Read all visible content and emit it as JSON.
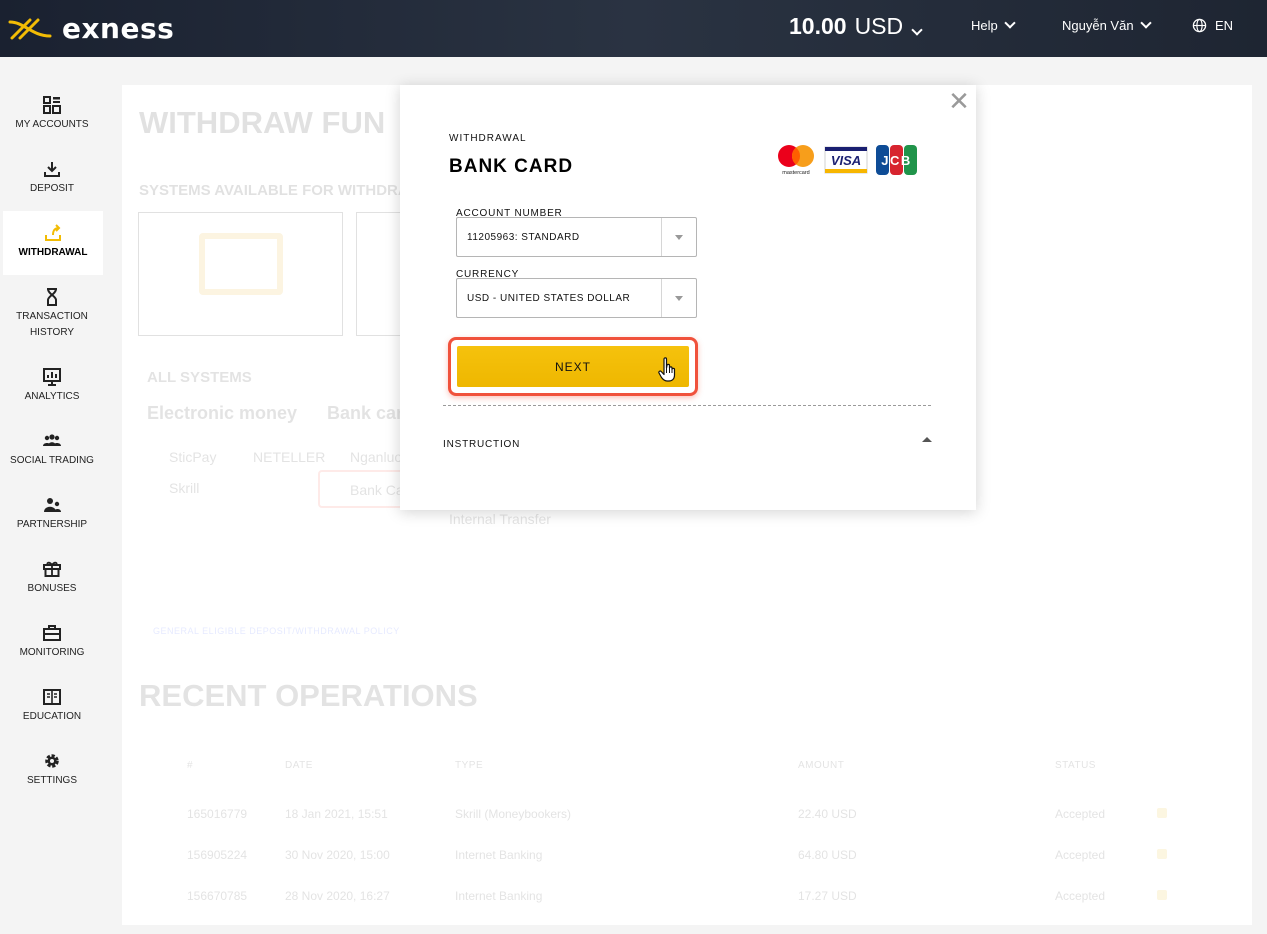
{
  "header": {
    "brand": "exness",
    "balance_amount": "10.00",
    "balance_currency": "USD",
    "help": "Help",
    "user": "Nguyễn Văn",
    "language": "EN"
  },
  "sidebar": {
    "items": [
      {
        "label": "MY ACCOUNTS",
        "icon": "grid-icon"
      },
      {
        "label": "DEPOSIT",
        "icon": "download-icon"
      },
      {
        "label": "WITHDRAWAL",
        "icon": "upload-icon"
      },
      {
        "label": "TRANSACTION HISTORY",
        "icon": "hourglass-icon"
      },
      {
        "label": "ANALYTICS",
        "icon": "chart-board-icon"
      },
      {
        "label": "SOCIAL TRADING",
        "icon": "users-icon"
      },
      {
        "label": "PARTNERSHIP",
        "icon": "partners-icon"
      },
      {
        "label": "BONUSES",
        "icon": "gift-icon"
      },
      {
        "label": "MONITORING",
        "icon": "briefcase-icon"
      },
      {
        "label": "EDUCATION",
        "icon": "book-icon"
      },
      {
        "label": "SETTINGS",
        "icon": "gear-icon"
      }
    ],
    "active_index": 2
  },
  "background": {
    "title": "WITHDRAW FUN",
    "systems_available": "SYSTEMS AVAILABLE FOR WITHDRAV",
    "all_systems": "ALL SYSTEMS",
    "tab_electronic": "Electronic money",
    "tab_bank": "Bank car",
    "systems": [
      "SticPay",
      "NETELLER",
      "Nganluo",
      "Skrill",
      "Bank Ca",
      "Internal Transfer"
    ],
    "link_text": "GENERAL ELIGIBLE DEPOSIT/WITHDRAWAL POLICY",
    "recent_title": "RECENT OPERATIONS",
    "columns": [
      "#",
      "DATE",
      "TYPE",
      "AMOUNT",
      "STATUS"
    ],
    "rows": [
      {
        "id": "165016779",
        "date": "18 Jan 2021, 15:51",
        "type": "Skrill (Moneybookers)",
        "amount": "22.40 USD",
        "status": "Accepted"
      },
      {
        "id": "156905224",
        "date": "30 Nov 2020, 15:00",
        "type": "Internet Banking",
        "amount": "64.80 USD",
        "status": "Accepted"
      },
      {
        "id": "156670785",
        "date": "28 Nov 2020, 16:27",
        "type": "Internet Banking",
        "amount": "17.27 USD",
        "status": "Accepted"
      }
    ]
  },
  "modal": {
    "overline": "WITHDRAWAL",
    "title": "BANK CARD",
    "card_brands": [
      "mastercard",
      "VISA",
      "JCB"
    ],
    "account_label": "ACCOUNT NUMBER",
    "account_value": "11205963: STANDARD",
    "currency_label": "CURRENCY",
    "currency_value": "USD - UNITED STATES DOLLAR",
    "next_label": "NEXT",
    "instruction_label": "INSTRUCTION"
  },
  "colors": {
    "accent": "#f2bc05",
    "highlight": "#f0523c",
    "header_bg": "#1e2532"
  }
}
